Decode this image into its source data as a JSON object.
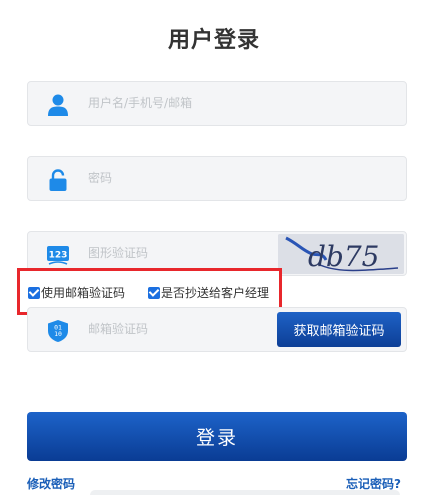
{
  "title": "用户登录",
  "username": {
    "placeholder": "用户名/手机号/邮箱",
    "icon": "user-icon"
  },
  "password": {
    "placeholder": "密码",
    "icon": "lock-icon"
  },
  "captcha": {
    "placeholder": "图形验证码",
    "icon": "123-icon",
    "image_text": "db75"
  },
  "options": {
    "use_email_code": {
      "label": "使用邮箱验证码",
      "checked": true
    },
    "cc_client_manager": {
      "label": "是否抄送给客户经理",
      "checked": true
    }
  },
  "email_code": {
    "placeholder": "邮箱验证码",
    "icon": "shield-binary-icon",
    "send_label": "获取邮箱验证码",
    "shield_text": "01\n10"
  },
  "login_label": "登录",
  "links": {
    "change_password": "修改密码",
    "forgot_password": "忘记密码?"
  },
  "colors": {
    "accent": "#1e62c6",
    "accent_dark": "#0a3c94",
    "icon": "#1e8ae8",
    "highlight_border": "#e8272c"
  }
}
